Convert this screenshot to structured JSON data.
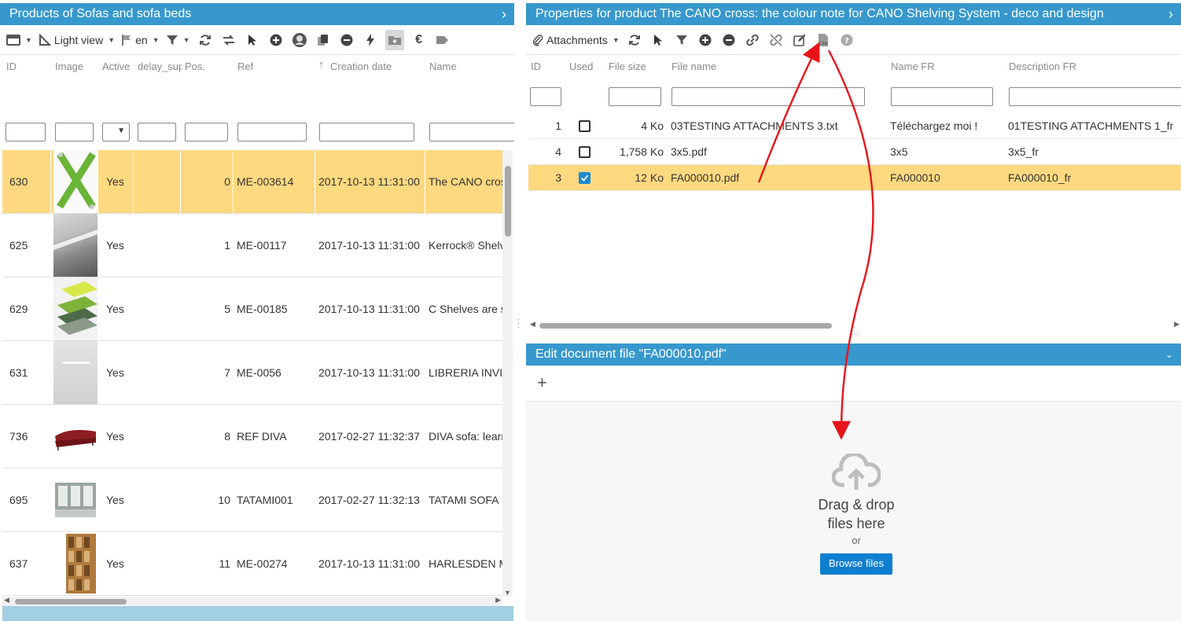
{
  "left_panel": {
    "title": "Products of Sofas and sofa beds",
    "toolbar": {
      "view_label": "Light view",
      "lang_label": "en"
    },
    "columns": [
      "ID",
      "Image",
      "Active",
      "delay_sup",
      "Pos.",
      "Ref",
      "Creation date",
      "Name"
    ],
    "rows": [
      {
        "id": "630",
        "active": "Yes",
        "pos": "0",
        "ref": "ME-003614",
        "date": "2017-10-13 11:31:00",
        "name": "The CANO cross",
        "image": "green-cross-image",
        "selected": true
      },
      {
        "id": "625",
        "active": "Yes",
        "pos": "1",
        "ref": "ME-00117",
        "date": "2017-10-13 11:31:00",
        "name": "Kerrock® Shelving",
        "image": "shelf-image",
        "selected": false
      },
      {
        "id": "629",
        "active": "Yes",
        "pos": "5",
        "ref": "ME-00185",
        "date": "2017-10-13 11:31:00",
        "name": "C Shelves are simple",
        "image": "c-shelves-image",
        "selected": false
      },
      {
        "id": "631",
        "active": "Yes",
        "pos": "7",
        "ref": "ME-0056",
        "date": "2017-10-13 11:31:00",
        "name": "LIBRERIA INVISIBILE",
        "image": "wall-shelf-image",
        "selected": false
      },
      {
        "id": "736",
        "active": "Yes",
        "pos": "8",
        "ref": "REF DIVA",
        "date": "2017-02-27 11:32:37",
        "name": "DIVA sofa: learn",
        "image": "red-sofa-image",
        "selected": false
      },
      {
        "id": "695",
        "active": "Yes",
        "pos": "10",
        "ref": "TATAMI001",
        "date": "2017-02-27 11:32:13",
        "name": "TATAMI SOFA",
        "image": "tatami-image",
        "selected": false
      },
      {
        "id": "637",
        "active": "Yes",
        "pos": "11",
        "ref": "ME-00274",
        "date": "2017-10-13 11:31:00",
        "name": "HARLESDEN Modular",
        "image": "bookcase-image",
        "selected": false
      }
    ]
  },
  "right_panel": {
    "title": "Properties for product The CANO cross: the colour note for CANO Shelving System - deco and design",
    "toolbar": {
      "attachments_label": "Attachments"
    },
    "columns": [
      "ID",
      "Used",
      "File size",
      "File name",
      "Name FR",
      "Description FR"
    ],
    "rows": [
      {
        "id": "1",
        "used": false,
        "size": "4 Ko",
        "file": "03TESTING ATTACHMENTS 3.txt",
        "name_fr": "Téléchargez moi !",
        "desc_fr": "01TESTING ATTACHMENTS 1_fr",
        "selected": false
      },
      {
        "id": "4",
        "used": false,
        "size": "1,758 Ko",
        "file": "3x5.pdf",
        "name_fr": "3x5",
        "desc_fr": "3x5_fr",
        "selected": false
      },
      {
        "id": "3",
        "used": true,
        "size": "12 Ko",
        "file": "FA000010.pdf",
        "name_fr": "FA000010",
        "desc_fr": "FA000010_fr",
        "selected": true
      }
    ]
  },
  "edit_panel": {
    "title": "Edit document file \"FA000010.pdf\"",
    "drop_text_1": "Drag & drop",
    "drop_text_2": "files here",
    "or_text": "or",
    "browse_label": "Browse files"
  },
  "colors": {
    "header_blue": "#3798cd",
    "selected_row": "#ffd980",
    "annotation_arrow": "#e8141b",
    "browse_button": "#0d7fd0"
  }
}
